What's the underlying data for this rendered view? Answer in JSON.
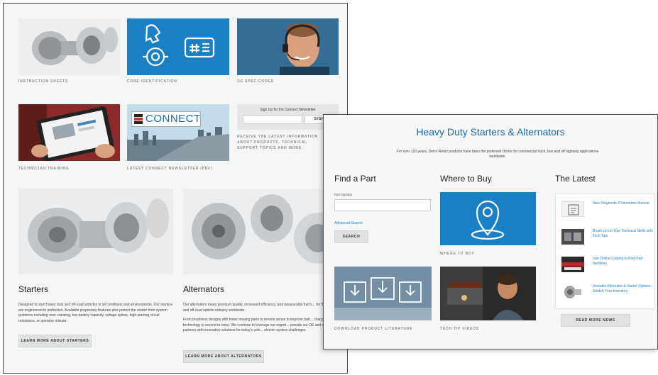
{
  "back_page": {
    "tiles": [
      {
        "caption": "INSTRUCTION SHEETS"
      },
      {
        "caption": "CORE IDENTIFICATION"
      },
      {
        "caption": "OE SPEC CODES"
      },
      {
        "caption": "TECHNICIAN TRAINING"
      },
      {
        "caption": "LATEST CONNECT NEWSLETTER (PDF)"
      }
    ],
    "connect_logo": "CONNECT",
    "newsletter": {
      "heading": "Sign Up for the Connect Newsletter",
      "button": "SIGN U",
      "description": "RECEIVE THE LATEST INFORMATION ABOUT PRODUCTS, TECHNICAL SUPPORT TOPICS AND MORE."
    },
    "starters": {
      "title": "Starters",
      "text": "Designed to start heavy duty and off-road vehicles in all conditions and environments. Our starters are engineered to perfection. Available proprietary features also protect the starter from system problems including over cranking, low battery capacity, voltage spikes, high-starting circuit resistance, or operator misuse.",
      "button": "LEARN MORE ABOUT STARTERS"
    },
    "alternators": {
      "title": "Alternators",
      "text1": "Our alternators mean premium quality, increased efficiency, and measurable fuel s... for the commercial and off-road vehicle industry worldwide.",
      "text2": "From brushless designs with fewer moving parts to remote sense to improve batt... charge time, our technology is second to none. We continue to leverage our expert... provide our OE and aftermarket partners with innovative solutions for today's vehi... electric system challenges.",
      "button": "LEARN MORE ABOUT ALTERNATORS"
    }
  },
  "front_page": {
    "title": "Heavy Duty Starters & Alternators",
    "intro": "For over 120 years, Delco Remy products have been the preferred choice for commercial truck, bus and off highway applications worldwide.",
    "find_part": {
      "heading": "Find a Part",
      "field_label": "Part Number",
      "field_value": "",
      "advanced": "Advanced Search",
      "search_button": "SEARCH"
    },
    "where_to_buy": {
      "heading": "Where to Buy",
      "caption": "WHERE TO BUY"
    },
    "latest": {
      "heading": "The Latest",
      "items": [
        {
          "title": "New Diagnostic Procedures Manual"
        },
        {
          "title": "Brush Up on Your Technical Skills with Tech Tips"
        },
        {
          "title": "Use Online Catalog to Find Part Numbers"
        },
        {
          "title": "Versatile Alternator & Starter Options Stretch Your Inventory"
        }
      ],
      "button": "READ MORE NEWS"
    },
    "literature_caption": "DOWNLOAD PRODUCT LITERATURE",
    "videos_caption": "TECH TIP VIDEOS"
  },
  "colors": {
    "accent_blue": "#1a7fc4",
    "title_blue": "#1a6aa8",
    "page_bg": "#f5f6f6"
  }
}
